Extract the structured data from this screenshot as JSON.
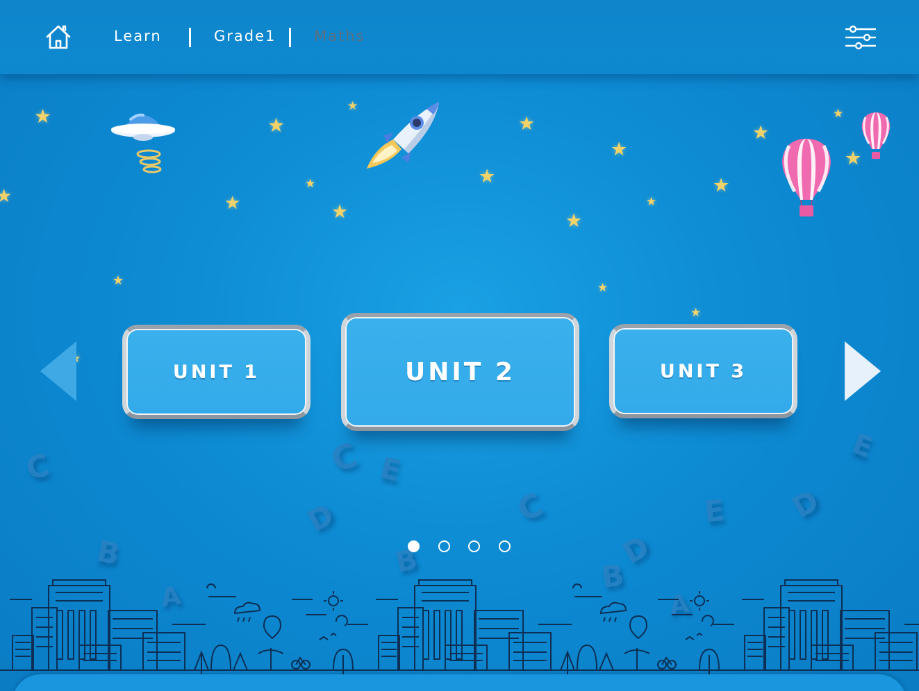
{
  "header": {
    "breadcrumbs": [
      "Learn",
      "Grade1",
      "Maths"
    ],
    "home_icon": "home-icon",
    "settings_icon": "sliders-icon"
  },
  "units": [
    {
      "label": "UNIT 1"
    },
    {
      "label": "UNIT 2"
    },
    {
      "label": "UNIT 3"
    }
  ],
  "pager": {
    "total": 4,
    "active": 1
  },
  "colors": {
    "background": "#0d8bd3",
    "header": "#0f86cc",
    "card": "#35abea",
    "card_border": "#c6ccd2",
    "star": "#f2d36a",
    "inactive_crumb": "#5a6f80"
  },
  "decor_letters": [
    "C",
    "E",
    "C",
    "D",
    "C",
    "E",
    "D",
    "B",
    "B",
    "B",
    "D",
    "A",
    "A",
    "E"
  ]
}
